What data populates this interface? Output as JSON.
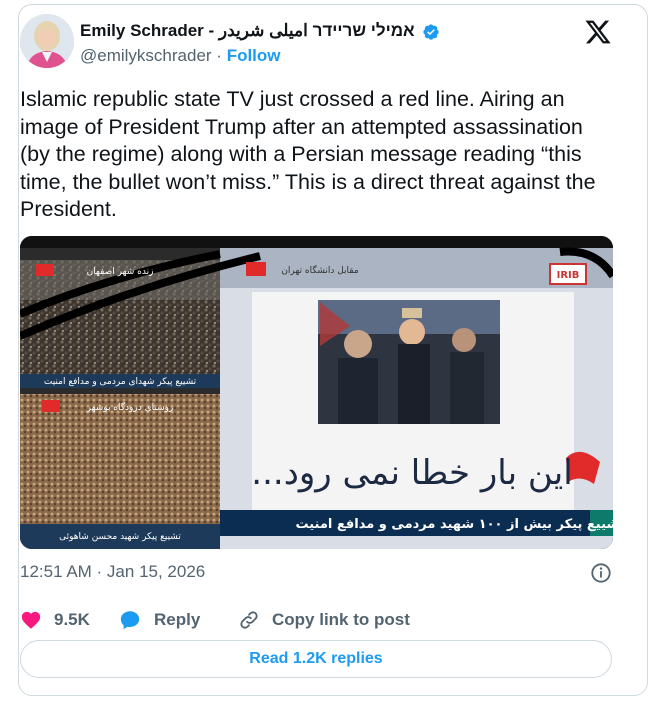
{
  "author": {
    "display_name": "Emily Schrader - אמילי שריידר امیلی شریدر",
    "handle": "@emilykschrader",
    "separator": " · ",
    "follow_label": "Follow"
  },
  "tweet": {
    "text": "Islamic republic state TV just crossed a red line. Airing an image of President Trump after an attempted assassination (by the regime) along with a Persian message reading “this time, the bullet won’t miss.” This is a direct threat against the President.",
    "timestamp": "12:51 AM · Jan 15, 2026"
  },
  "media": {
    "top_left_caption": "تشییع پیکر شهدای مردمی و مدافع امنیت",
    "bottom_left_caption": "تشییع پیکر شهید محسن شاهوئی",
    "top_left_location": "زنده شهر اصفهان",
    "bottom_left_location": "روستای درودگاه بوشهر",
    "center_location": "مقابل دانشگاه تهران",
    "banner_message": "این بار خطا نمی رود...",
    "ticker": "تشییع پیکر بیش از ۱۰۰ شهید مردمی و مدافع امنیت",
    "channel_logo": "IRIB"
  },
  "engagement": {
    "likes": "9.5K",
    "reply_label": "Reply",
    "copy_link_label": "Copy link to post",
    "read_replies_label": "Read 1.2K replies"
  },
  "colors": {
    "accent": "#1d9bf0",
    "like": "#f91880",
    "text": "#0f1419",
    "muted": "#536471",
    "border": "#cfd9de"
  },
  "icons": [
    "verified-badge-icon",
    "x-logo-icon",
    "info-icon",
    "heart-icon",
    "reply-icon",
    "link-icon"
  ]
}
